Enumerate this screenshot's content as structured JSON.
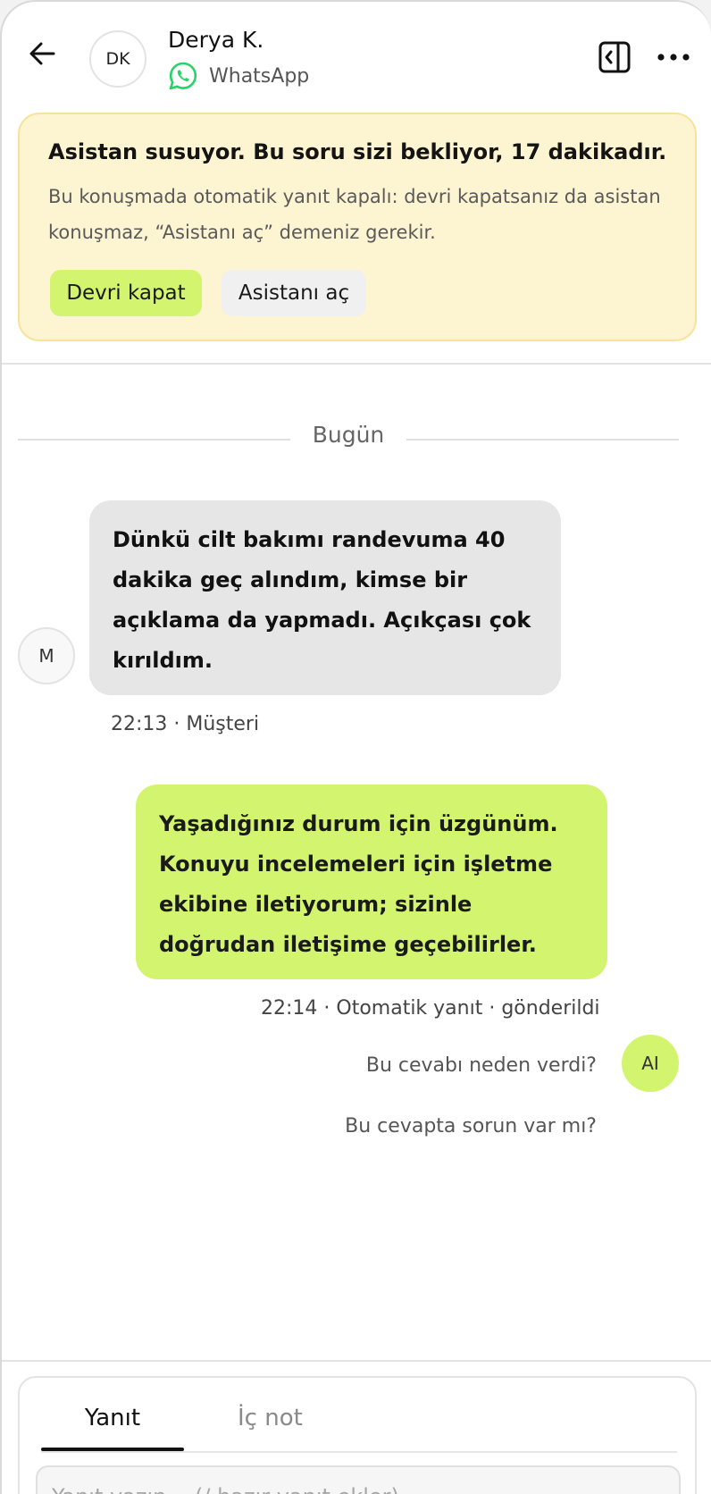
{
  "header": {
    "avatar_initials": "DK",
    "contact_name": "Derya K.",
    "channel": "WhatsApp",
    "icons": {
      "back": "arrow-left-icon",
      "channel": "whatsapp-icon",
      "panel": "side-panel-icon",
      "more": "more-horizontal-icon"
    }
  },
  "alert": {
    "title": "Asistan susuyor. Bu soru sizi bekliyor, 17 dakikadır.",
    "body": "Bu konuşmada otomatik yanıt kapalı: devri kapatsanız da asistan konuşmaz, “Asistanı aç” demeniz gerekir.",
    "primary_action": "Devri kapat",
    "secondary_action": "Asistanı aç"
  },
  "conversation": {
    "date_label": "Bugün",
    "customer_message": {
      "avatar_initial": "M",
      "text": "Dünkü cilt bakımı randevuma 40 dakika geç alındım, kimse bir açıklama da yapmadı. Açıkçası çok kırıldım.",
      "meta": "22:13 · Müşteri"
    },
    "bot_message": {
      "text": "Yaşadığınız durum için üzgünüm. Konuyu incelemeleri için işletme ekibine iletiyorum; sizinle doğrudan iletişime geçebilirler.",
      "meta": "22:14 · Otomatik yanıt · gönderildi",
      "avatar_initial": "AI",
      "why_link": "Bu cevabı neden verdi?",
      "problem_link": "Bu cevapta sorun var mı?"
    }
  },
  "composer": {
    "tabs": [
      "Yanıt",
      "İç not"
    ],
    "active_tab": "Yanıt",
    "placeholder": "Yanıt yazın… (/ hazır yanıt ekler)"
  },
  "colors": {
    "accent": "#d3f46e",
    "alert_bg": "#fdf4d2",
    "alert_border": "#f6e49a",
    "customer_bubble": "#e6e6e6",
    "whatsapp": "#25d366"
  }
}
